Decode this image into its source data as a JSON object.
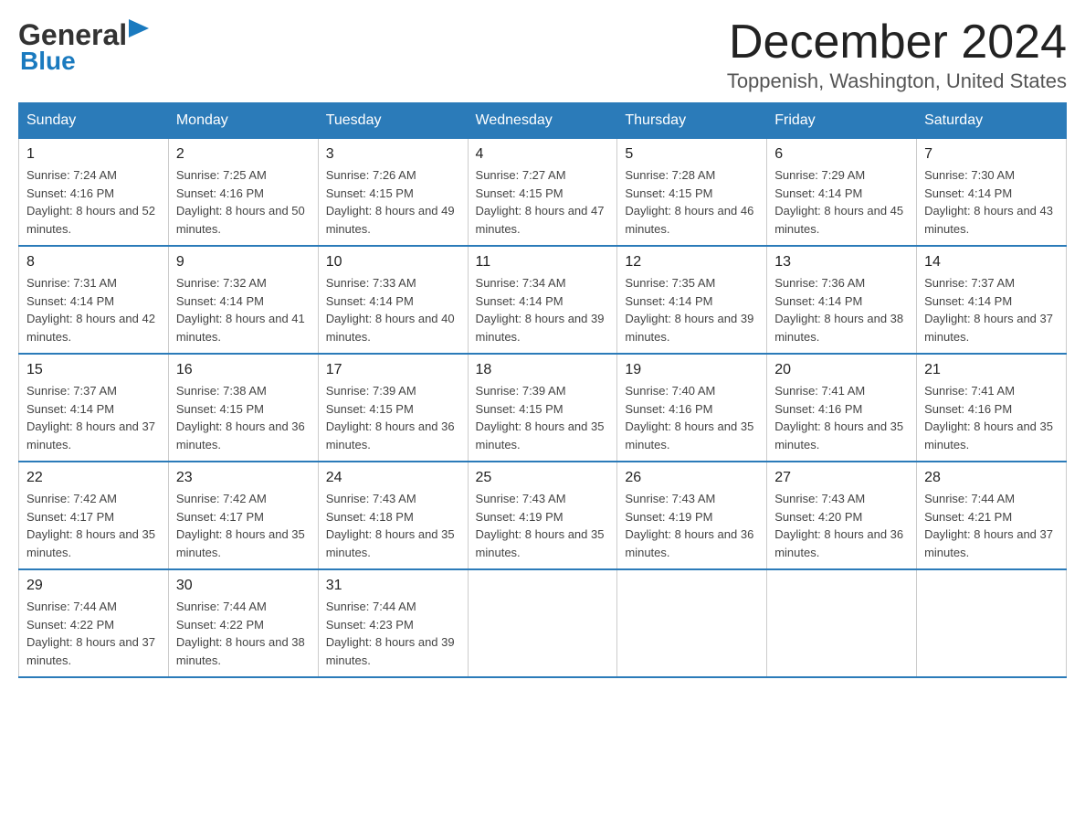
{
  "header": {
    "logo_general": "General",
    "logo_blue": "Blue",
    "month_title": "December 2024",
    "location": "Toppenish, Washington, United States"
  },
  "weekdays": [
    "Sunday",
    "Monday",
    "Tuesday",
    "Wednesday",
    "Thursday",
    "Friday",
    "Saturday"
  ],
  "weeks": [
    [
      {
        "day": "1",
        "sunrise": "7:24 AM",
        "sunset": "4:16 PM",
        "daylight": "8 hours and 52 minutes."
      },
      {
        "day": "2",
        "sunrise": "7:25 AM",
        "sunset": "4:16 PM",
        "daylight": "8 hours and 50 minutes."
      },
      {
        "day": "3",
        "sunrise": "7:26 AM",
        "sunset": "4:15 PM",
        "daylight": "8 hours and 49 minutes."
      },
      {
        "day": "4",
        "sunrise": "7:27 AM",
        "sunset": "4:15 PM",
        "daylight": "8 hours and 47 minutes."
      },
      {
        "day": "5",
        "sunrise": "7:28 AM",
        "sunset": "4:15 PM",
        "daylight": "8 hours and 46 minutes."
      },
      {
        "day": "6",
        "sunrise": "7:29 AM",
        "sunset": "4:14 PM",
        "daylight": "8 hours and 45 minutes."
      },
      {
        "day": "7",
        "sunrise": "7:30 AM",
        "sunset": "4:14 PM",
        "daylight": "8 hours and 43 minutes."
      }
    ],
    [
      {
        "day": "8",
        "sunrise": "7:31 AM",
        "sunset": "4:14 PM",
        "daylight": "8 hours and 42 minutes."
      },
      {
        "day": "9",
        "sunrise": "7:32 AM",
        "sunset": "4:14 PM",
        "daylight": "8 hours and 41 minutes."
      },
      {
        "day": "10",
        "sunrise": "7:33 AM",
        "sunset": "4:14 PM",
        "daylight": "8 hours and 40 minutes."
      },
      {
        "day": "11",
        "sunrise": "7:34 AM",
        "sunset": "4:14 PM",
        "daylight": "8 hours and 39 minutes."
      },
      {
        "day": "12",
        "sunrise": "7:35 AM",
        "sunset": "4:14 PM",
        "daylight": "8 hours and 39 minutes."
      },
      {
        "day": "13",
        "sunrise": "7:36 AM",
        "sunset": "4:14 PM",
        "daylight": "8 hours and 38 minutes."
      },
      {
        "day": "14",
        "sunrise": "7:37 AM",
        "sunset": "4:14 PM",
        "daylight": "8 hours and 37 minutes."
      }
    ],
    [
      {
        "day": "15",
        "sunrise": "7:37 AM",
        "sunset": "4:14 PM",
        "daylight": "8 hours and 37 minutes."
      },
      {
        "day": "16",
        "sunrise": "7:38 AM",
        "sunset": "4:15 PM",
        "daylight": "8 hours and 36 minutes."
      },
      {
        "day": "17",
        "sunrise": "7:39 AM",
        "sunset": "4:15 PM",
        "daylight": "8 hours and 36 minutes."
      },
      {
        "day": "18",
        "sunrise": "7:39 AM",
        "sunset": "4:15 PM",
        "daylight": "8 hours and 35 minutes."
      },
      {
        "day": "19",
        "sunrise": "7:40 AM",
        "sunset": "4:16 PM",
        "daylight": "8 hours and 35 minutes."
      },
      {
        "day": "20",
        "sunrise": "7:41 AM",
        "sunset": "4:16 PM",
        "daylight": "8 hours and 35 minutes."
      },
      {
        "day": "21",
        "sunrise": "7:41 AM",
        "sunset": "4:16 PM",
        "daylight": "8 hours and 35 minutes."
      }
    ],
    [
      {
        "day": "22",
        "sunrise": "7:42 AM",
        "sunset": "4:17 PM",
        "daylight": "8 hours and 35 minutes."
      },
      {
        "day": "23",
        "sunrise": "7:42 AM",
        "sunset": "4:17 PM",
        "daylight": "8 hours and 35 minutes."
      },
      {
        "day": "24",
        "sunrise": "7:43 AM",
        "sunset": "4:18 PM",
        "daylight": "8 hours and 35 minutes."
      },
      {
        "day": "25",
        "sunrise": "7:43 AM",
        "sunset": "4:19 PM",
        "daylight": "8 hours and 35 minutes."
      },
      {
        "day": "26",
        "sunrise": "7:43 AM",
        "sunset": "4:19 PM",
        "daylight": "8 hours and 36 minutes."
      },
      {
        "day": "27",
        "sunrise": "7:43 AM",
        "sunset": "4:20 PM",
        "daylight": "8 hours and 36 minutes."
      },
      {
        "day": "28",
        "sunrise": "7:44 AM",
        "sunset": "4:21 PM",
        "daylight": "8 hours and 37 minutes."
      }
    ],
    [
      {
        "day": "29",
        "sunrise": "7:44 AM",
        "sunset": "4:22 PM",
        "daylight": "8 hours and 37 minutes."
      },
      {
        "day": "30",
        "sunrise": "7:44 AM",
        "sunset": "4:22 PM",
        "daylight": "8 hours and 38 minutes."
      },
      {
        "day": "31",
        "sunrise": "7:44 AM",
        "sunset": "4:23 PM",
        "daylight": "8 hours and 39 minutes."
      },
      null,
      null,
      null,
      null
    ]
  ],
  "labels": {
    "sunrise": "Sunrise:",
    "sunset": "Sunset:",
    "daylight": "Daylight:"
  }
}
